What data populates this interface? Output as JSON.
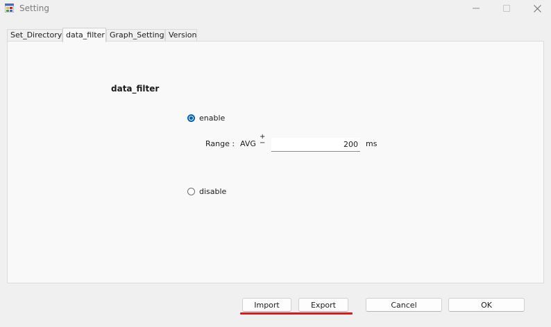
{
  "window": {
    "title": "Setting",
    "app_icon": "windows-form-icon",
    "controls": [
      "minimize-icon",
      "maximize-icon",
      "close-icon"
    ]
  },
  "tabs": [
    {
      "label": "Set_Directory",
      "active": false
    },
    {
      "label": "data_filter",
      "active": true
    },
    {
      "label": "Graph_Setting",
      "active": false
    },
    {
      "label": "Version",
      "active": false
    }
  ],
  "panel": {
    "title": "data_filter",
    "options": {
      "enable_label": "enable",
      "enable_checked": true,
      "disable_label": "disable",
      "disable_checked": false
    },
    "range": {
      "label": "Range :",
      "avg_label": "AVG",
      "plus": "+",
      "minus": "−",
      "value": "200",
      "unit": "ms"
    }
  },
  "buttons": {
    "import": "Import",
    "export": "Export",
    "cancel": "Cancel",
    "ok": "OK"
  },
  "colors": {
    "accent": "#005fb8",
    "annotation": "#e0161d",
    "window_bg": "#f0f0f0",
    "panel_bg": "#f9f9f9"
  }
}
